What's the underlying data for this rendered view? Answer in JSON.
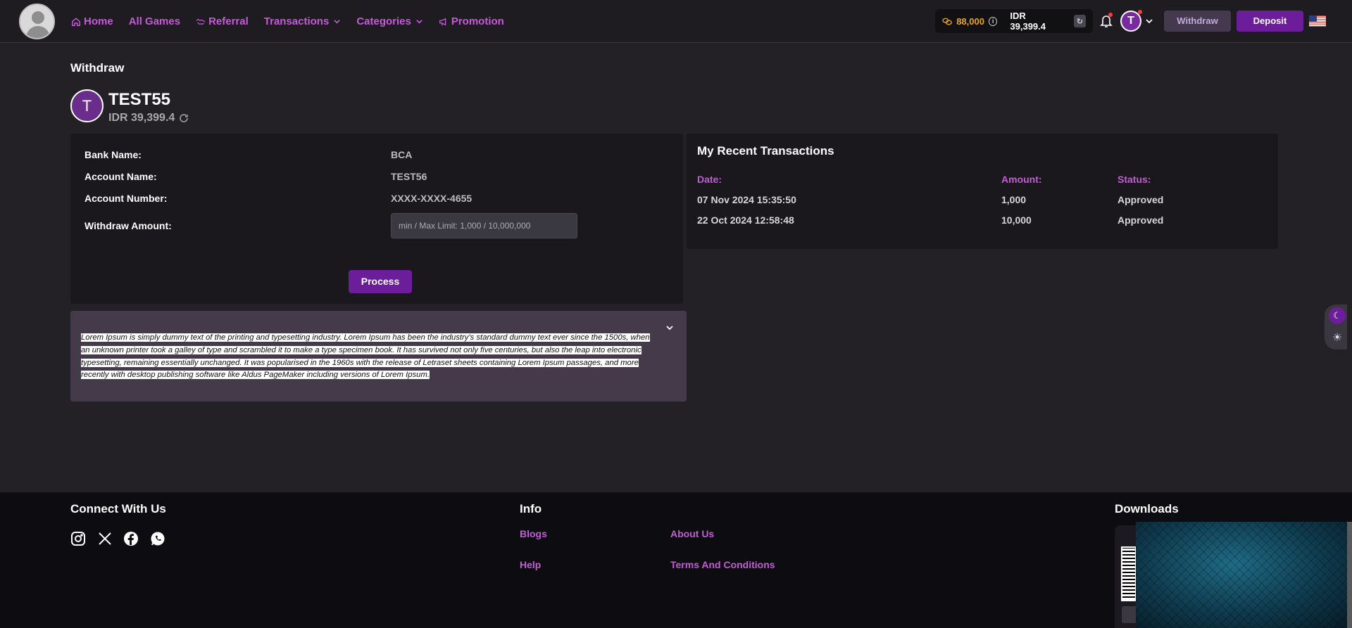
{
  "header": {
    "nav": [
      {
        "label": "Home",
        "icon": "home-icon"
      },
      {
        "label": "All Games"
      },
      {
        "label": "Referral",
        "icon": "handshake-icon"
      },
      {
        "label": "Transactions",
        "dropdown": true
      },
      {
        "label": "Categories",
        "dropdown": true
      },
      {
        "label": "Promotion",
        "icon": "megaphone-icon"
      }
    ],
    "coins": "88,000",
    "balance": "IDR 39,399.4",
    "user_initial": "T",
    "withdraw_label": "Withdraw",
    "deposit_label": "Deposit",
    "flag": "us-flag"
  },
  "page": {
    "title": "Withdraw",
    "profile": {
      "initial": "T",
      "name": "TEST55",
      "balance": "IDR 39,399.4"
    }
  },
  "withdraw_form": {
    "bank_name_label": "Bank Name:",
    "bank_name_value": "BCA",
    "account_name_label": "Account Name:",
    "account_name_value": "TEST56",
    "account_number_label": "Account Number:",
    "account_number_value": "XXXX-XXXX-4655",
    "amount_label": "Withdraw Amount:",
    "amount_placeholder": "min / Max Limit: 1,000 / 10,000,000",
    "process_label": "Process"
  },
  "transactions": {
    "title": "My Recent Transactions",
    "headers": {
      "date": "Date:",
      "amount": "Amount:",
      "status": "Status:"
    },
    "rows": [
      {
        "date": "07 Nov 2024 15:35:50",
        "amount": "1,000",
        "status": "Approved"
      },
      {
        "date": "22 Oct 2024 12:58:48",
        "amount": "10,000",
        "status": "Approved"
      }
    ]
  },
  "notice": {
    "text": "Lorem Ipsum is simply dummy text of the printing and typesetting industry. Lorem Ipsum has been the industry's standard dummy text ever since the 1500s, when an unknown printer took a galley of type and scrambled it to make a type specimen book. It has survived not only five centuries, but also the leap into electronic typesetting, remaining essentially unchanged. It was popularised in the 1960s with the release of Letraset sheets containing Lorem Ipsum passages, and more recently with desktop publishing software like Aldus PageMaker including versions of Lorem Ipsum."
  },
  "footer": {
    "connect_title": "Connect With Us",
    "social": [
      "instagram-icon",
      "x-icon",
      "facebook-icon",
      "whatsapp-icon"
    ],
    "info_title": "Info",
    "links": {
      "blogs": "Blogs",
      "about": "About Us",
      "help": "Help",
      "terms": "Terms And Conditions"
    },
    "downloads_title": "Downloads"
  },
  "colors": {
    "accent": "#c45bd8",
    "primary": "#6c1d9a",
    "coin": "#e6a623"
  }
}
